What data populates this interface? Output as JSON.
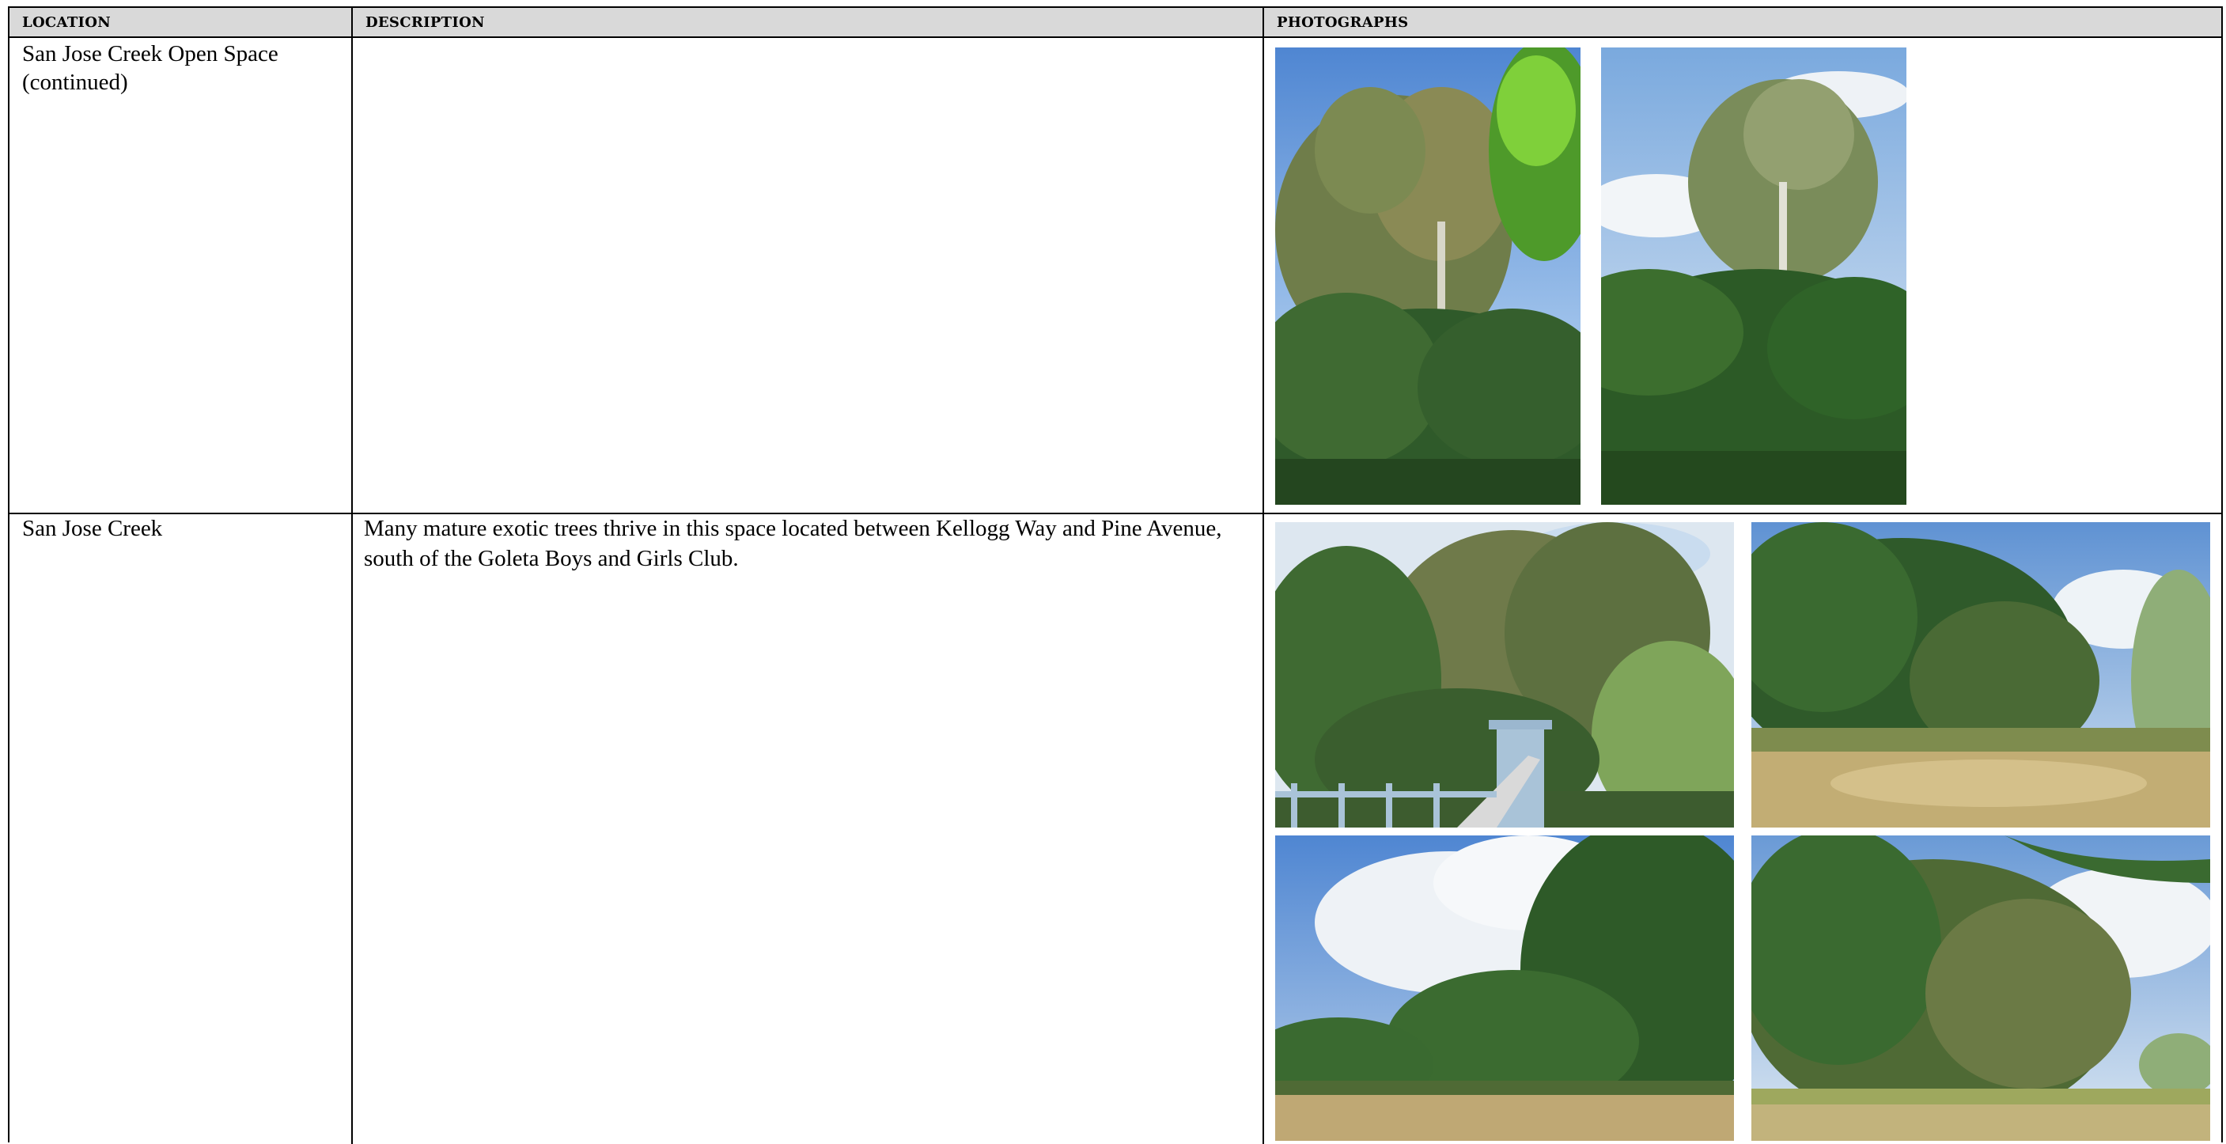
{
  "table": {
    "headers": {
      "location": "LOCATION",
      "description": "DESCRIPTION",
      "photographs": "PHOTOGRAPHS"
    },
    "rows": [
      {
        "location_line1": "San Jose Creek Open Space",
        "location_line2": "(continued)",
        "description": "",
        "photos": [
          "tall-sycamore-tree-photo",
          "sycamore-tree-with-shrubs-photo"
        ]
      },
      {
        "location_line1": "San Jose Creek",
        "description_line1": "Many mature exotic trees thrive in this space located between Kellogg Way and Pine Avenue,",
        "description_line2": "south of the Goleta Boys and Girls Club.",
        "photos": [
          "trees-behind-playground-photo",
          "tree-grove-dry-field-photo",
          "trees-under-cloudy-sky-photo",
          "tree-stand-with-willow-photo"
        ]
      }
    ]
  },
  "colors": {
    "header_bg": "#d9d9d9",
    "sky_blue": "#6f9fd8",
    "foliage_dark": "#2f5a2a",
    "foliage_light": "#6f8f3f",
    "dry_grass": "#c2ad74"
  }
}
